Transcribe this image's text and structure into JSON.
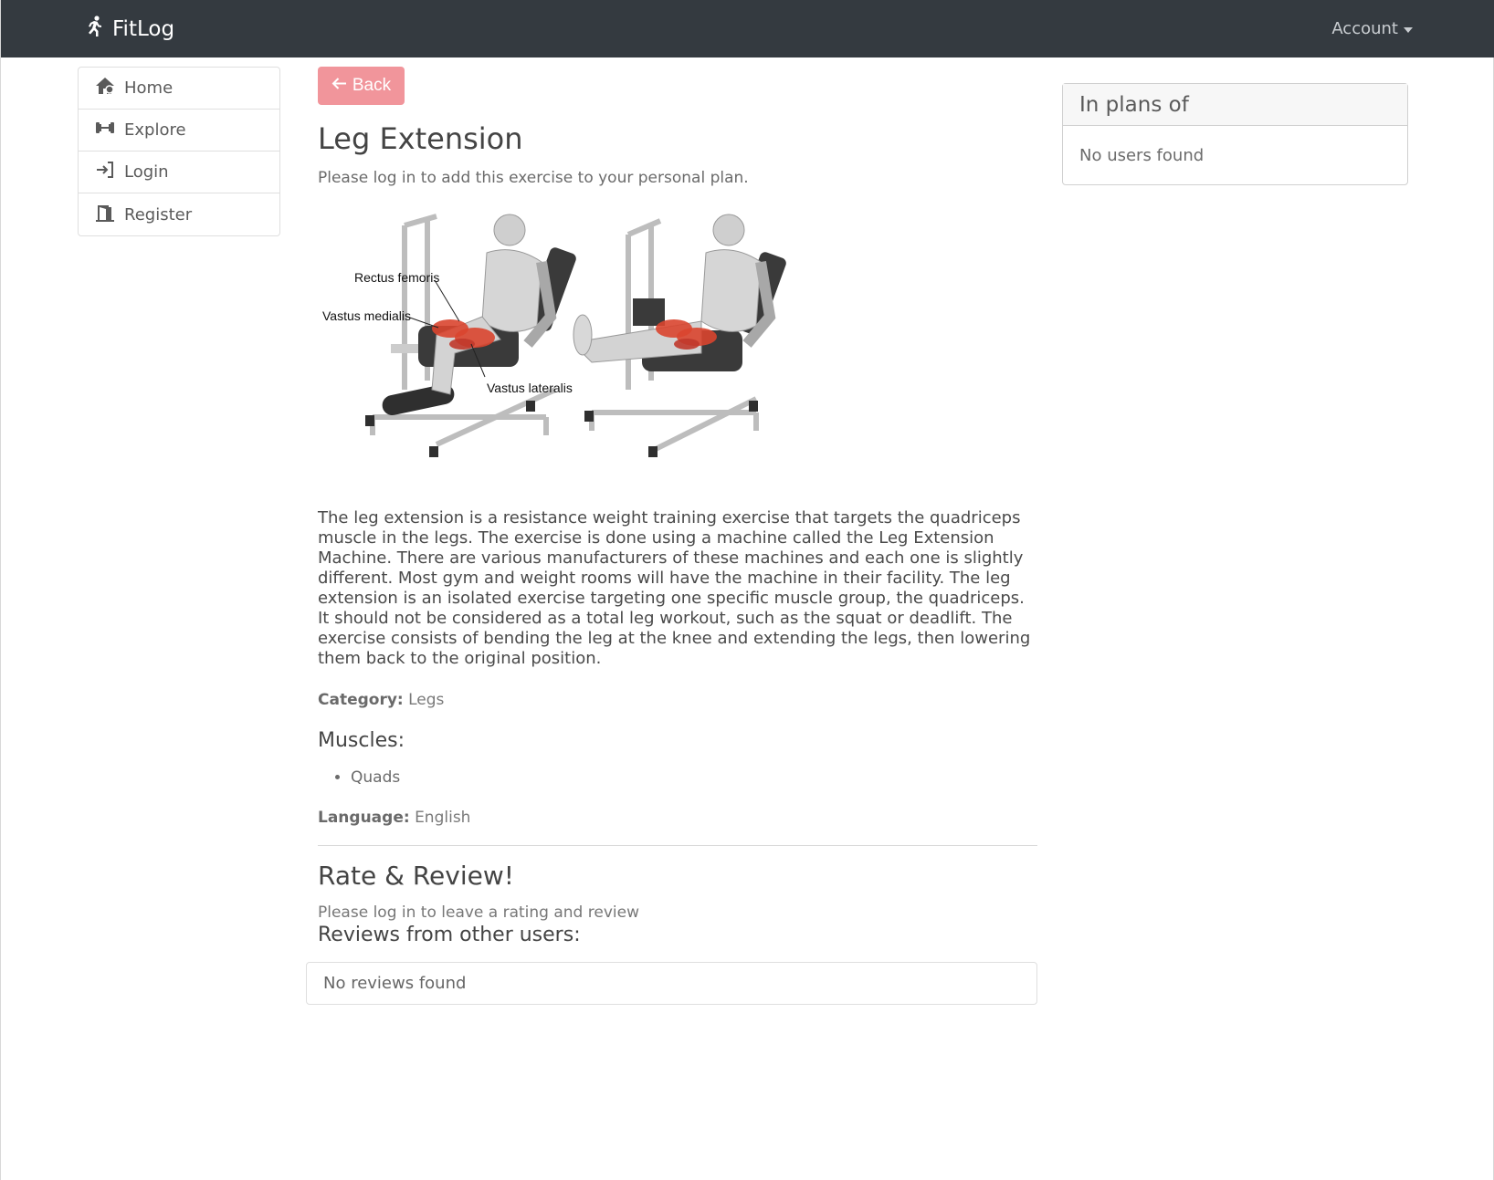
{
  "navbar": {
    "brand": "FitLog",
    "brand_icon": "running-person-icon",
    "account_label": "Account"
  },
  "sidebar": {
    "items": [
      {
        "label": "Home",
        "icon": "home-icon"
      },
      {
        "label": "Explore",
        "icon": "dumbbell-icon"
      },
      {
        "label": "Login",
        "icon": "login-icon"
      },
      {
        "label": "Register",
        "icon": "door-icon"
      }
    ]
  },
  "main": {
    "back_label": "Back",
    "title": "Leg Extension",
    "login_note": "Please log in to add this exercise to your personal plan.",
    "illustration": {
      "labels": [
        "Rectus femoris",
        "Vastus medialis",
        "Vastus lateralis"
      ]
    },
    "description": "The leg extension is a resistance weight training exercise that targets the quadriceps muscle in the legs. The exercise is done using a machine called the Leg Extension Machine. There are various manufacturers of these machines and each one is slightly different. Most gym and weight rooms will have the machine in their facility. The leg extension is an isolated exercise targeting one specific muscle group, the quadriceps. It should not be considered as a total leg workout, such as the squat or deadlift. The exercise consists of bending the leg at the knee and extending the legs, then lowering them back to the original position.",
    "category_label": "Category:",
    "category_value": "Legs",
    "muscles_heading": "Muscles:",
    "muscles": [
      "Quads"
    ],
    "language_label": "Language:",
    "language_value": "English",
    "rate_heading": "Rate & Review!",
    "rate_note": "Please log in to leave a rating and review",
    "reviews_heading": "Reviews from other users:",
    "reviews_empty": "No reviews found"
  },
  "plans": {
    "header": "In plans of",
    "empty": "No users found"
  },
  "colors": {
    "navbar_bg": "#343a40",
    "back_button": "#f1959b",
    "muscle_highlight": "#d9452f"
  }
}
